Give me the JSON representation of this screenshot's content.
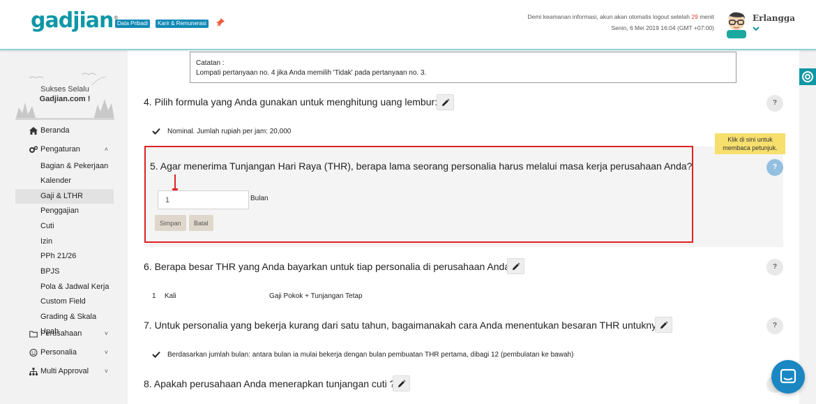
{
  "header": {
    "logo_text": "gadjian",
    "logo_mark": "®",
    "tags": [
      "Data Pribadi",
      "Karir & Remunerasi"
    ],
    "notice_prefix": "Demi keamanan informasi, akun akan otomatis logout setelah ",
    "notice_minutes": "29",
    "notice_suffix": " menit",
    "datetime": "Senin, 6 Mei 2019 16:04 (GMT +07:00)",
    "username": "Erlangga"
  },
  "sidebar": {
    "brand_line1": "Sukses Selalu",
    "brand_line2": "Gadjian.com !",
    "nav": [
      {
        "label": "Beranda"
      },
      {
        "label": "Pengaturan",
        "chevron": "˄"
      },
      {
        "label": "Perusahaan",
        "chevron": "˅"
      },
      {
        "label": "Personalia",
        "chevron": "˅"
      },
      {
        "label": "Multi Approval",
        "chevron": "˅"
      }
    ],
    "sub_items": [
      "Bagian & Pekerjaan",
      "Kalender",
      "Gaji & LTHR",
      "Penggajian",
      "Cuti",
      "Izin",
      "PPh 21/26",
      "BPJS",
      "Pola & Jadwal Kerja",
      "Custom Field",
      "Grading & Skala Upah"
    ]
  },
  "main": {
    "note_title": "Catatan :",
    "note_body": "Lompati pertanyaan no. 4 jika Anda memilih 'Tidak' pada pertanyaan no. 3.",
    "help_label": "?",
    "q4": {
      "text": "4. Pilih formula yang Anda gunakan untuk menghitung uang lembur:",
      "answer": "Nominal. Jumlah rupiah per jam: 20,000"
    },
    "q5": {
      "text": "5. Agar menerima Tunjangan Hari Raya (THR), berapa lama seorang personalia harus melalui masa kerja perusahaan Anda?",
      "input_value": "1",
      "unit": "Bulan",
      "save_label": "Simpan",
      "cancel_label": "Batal",
      "tooltip": "Klik di sini untuk membaca petunjuk."
    },
    "q6": {
      "text": "6. Berapa besar THR yang Anda bayarkan untuk tiap personalia di perusahaan Anda?",
      "row_num": "1",
      "row_unit": "Kali",
      "row_component": "Gaji Pokok + Tunjangan Tetap"
    },
    "q7": {
      "text": "7. Untuk personalia yang bekerja kurang dari satu tahun, bagaimanakah cara Anda menentukan besaran THR untuknya?",
      "answer": "Berdasarkan jumlah bulan: antara bulan ia mulai bekerja dengan bulan pembuatan THR pertama, dibagi 12 (pembulatan ke bawah)"
    },
    "q8": {
      "text": "8. Apakah perusahaan Anda menerapkan tunjangan cuti ?"
    }
  }
}
